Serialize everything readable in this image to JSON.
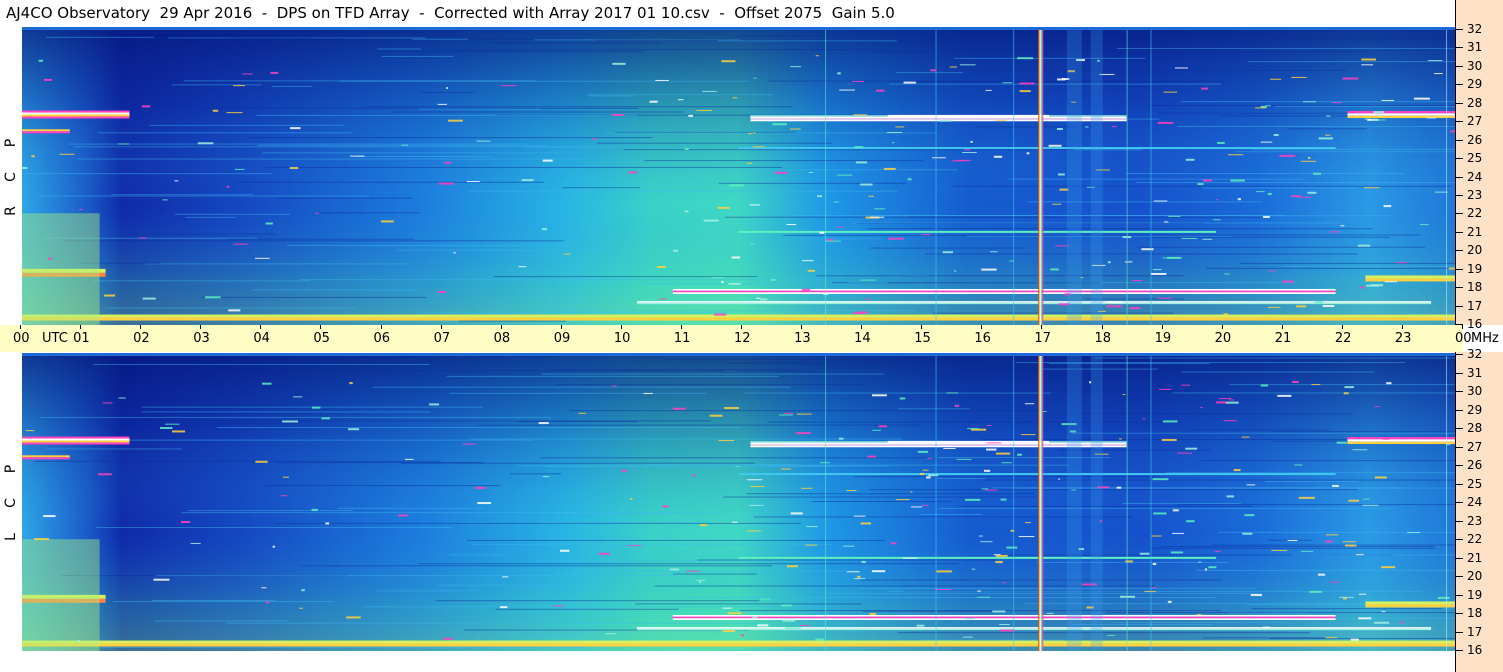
{
  "title": "AJ4CO Observatory  29 Apr 2016  -  DPS on TFD Array  -  Corrected with Array 2017 01 10.csv  -  Offset 2075  Gain 5.0",
  "panels": [
    {
      "polarization": [
        "R",
        "C",
        "P"
      ]
    },
    {
      "polarization": [
        "L",
        "C",
        "P"
      ]
    }
  ],
  "chart_data": {
    "type": "heatmap",
    "title": "AJ4CO Observatory  29 Apr 2016  -  DPS on TFD Array  -  Corrected with Array 2017 01 10.csv  -  Offset 2075  Gain 5.0",
    "time_ticks": [
      "00",
      "UTC",
      "01",
      "02",
      "03",
      "04",
      "05",
      "06",
      "07",
      "08",
      "09",
      "10",
      "11",
      "12",
      "13",
      "14",
      "15",
      "16",
      "17",
      "18",
      "19",
      "20",
      "21",
      "22",
      "23",
      "00",
      "MHz"
    ],
    "time_range_utc": [
      0,
      24
    ],
    "freq_ticks": [
      "32",
      "31",
      "30",
      "29",
      "28",
      "27",
      "26",
      "25",
      "24",
      "23",
      "22",
      "21",
      "20",
      "19",
      "18",
      "17",
      "16"
    ],
    "freq_range_mhz": [
      16,
      32
    ],
    "colors": {
      "low": "#0b1f8f",
      "mid": "#1f8ef0",
      "high": "#5ff0b0",
      "peak": "#ffffff",
      "interference": "#ff40c0"
    }
  }
}
